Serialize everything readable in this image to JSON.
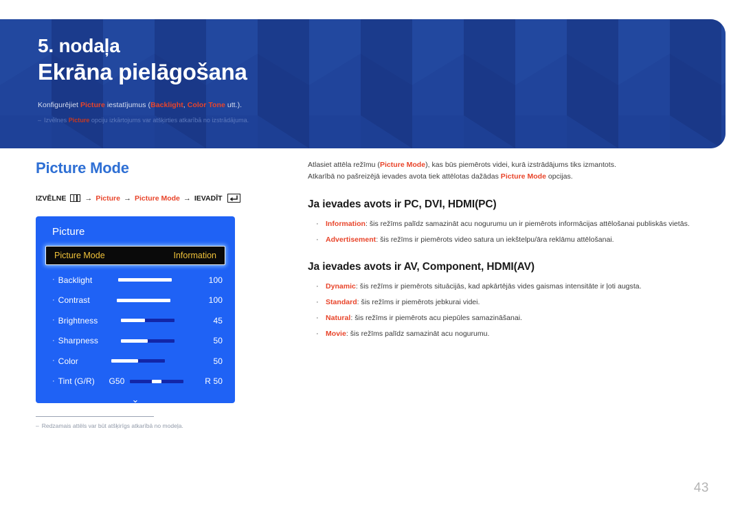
{
  "banner": {
    "chapter_number": "5. nodaļa",
    "chapter_title": "Ekrāna pielāgošana",
    "subtitle_pre": "Konfigurējiet ",
    "subtitle_hl1": "Picture",
    "subtitle_mid": " iestatījumus (",
    "subtitle_hl2": "Backlight",
    "subtitle_mid2": ", ",
    "subtitle_hl3": "Color Tone",
    "subtitle_post": " utt.).",
    "note_dash": "‒",
    "note_pre": "Izvēlnes ",
    "note_hl": "Picture",
    "note_post": " opciju izkārtojums var atšķirties atkarībā no izstrādājuma.",
    "bg_color": "#1d3f94"
  },
  "left": {
    "section_title": "Picture Mode",
    "menu_path": {
      "menu_label": "IZVĒLNE",
      "menu_icon": "menu-grid-icon",
      "arrow": "→",
      "step1": "Picture",
      "step2": "Picture Mode",
      "enter_label": "IEVADĪT",
      "enter_icon": "enter-key-icon"
    },
    "osd": {
      "title": "Picture",
      "selected_row": {
        "label": "Picture Mode",
        "value": "Information"
      },
      "rows": [
        {
          "label": "Backlight",
          "value": "100",
          "fill": 100
        },
        {
          "label": "Contrast",
          "value": "100",
          "fill": 100
        },
        {
          "label": "Brightness",
          "value": "45",
          "fill": 45
        },
        {
          "label": "Sharpness",
          "value": "50",
          "fill": 50
        },
        {
          "label": "Color",
          "value": "50",
          "fill": 50
        }
      ],
      "tint_row": {
        "label": "Tint (G/R)",
        "left_value": "G50",
        "right_value": "R 50"
      },
      "chevron": "⌄",
      "panel_color": "#1f62f5",
      "highlight_text_color": "#f0c23a"
    },
    "footnote": {
      "dash": "‒",
      "text": "Redzamais attēls var būt atšķirīgs atkarībā no modeļa."
    }
  },
  "right": {
    "intro_line1_pre": "Atlasiet attēla režīmu (",
    "intro_line1_hl": "Picture Mode",
    "intro_line1_post": "), kas būs piemērots videi, kurā izstrādājums tiks izmantots.",
    "intro_line2_pre": "Atkarībā no pašreizējā ievades avota tiek attēlotas dažādas ",
    "intro_line2_hl": "Picture Mode",
    "intro_line2_post": " opcijas.",
    "section1_heading": "Ja ievades avots ir PC, DVI, HDMI(PC)",
    "section1_bullets": [
      {
        "term": "Information",
        "desc": ": šis režīms palīdz samazināt acu nogurumu un ir piemērots informācijas attēlošanai publiskās vietās."
      },
      {
        "term": "Advertisement",
        "desc": ": šis režīms ir piemērots video satura un iekštelpu/āra reklāmu attēlošanai."
      }
    ],
    "section2_heading": "Ja ievades avots ir AV, Component, HDMI(AV)",
    "section2_bullets": [
      {
        "term": "Dynamic",
        "desc": ": šis režīms ir piemērots situācijās, kad apkārtējās vides gaismas intensitāte ir ļoti augsta."
      },
      {
        "term": "Standard",
        "desc": ": šis režīms ir piemērots jebkurai videi."
      },
      {
        "term": "Natural",
        "desc": ": šis režīms ir piemērots acu piepūles samazināšanai."
      },
      {
        "term": "Movie",
        "desc": ": šis režīms palīdz samazināt acu nogurumu."
      }
    ],
    "bullet_marker": "·"
  },
  "page_number": "43",
  "accent_color": "#e8442a",
  "heading_color": "#2e6fd4"
}
